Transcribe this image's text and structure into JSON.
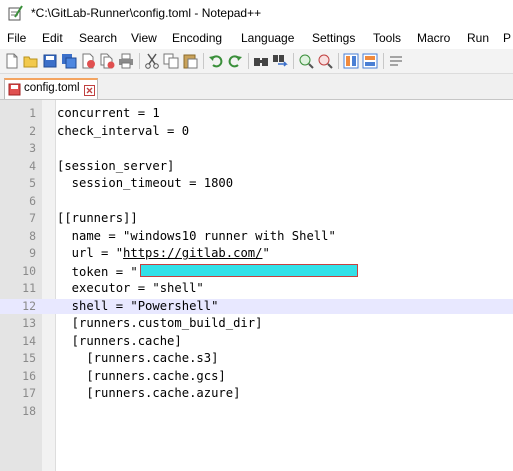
{
  "window": {
    "title": "*C:\\GitLab-Runner\\config.toml - Notepad++"
  },
  "menu": [
    "File",
    "Edit",
    "Search",
    "View",
    "Encoding",
    "Language",
    "Settings",
    "Tools",
    "Macro",
    "Run",
    "P"
  ],
  "toolbar_icons": [
    "new-file-icon",
    "open-file-icon",
    "save-icon",
    "save-all-icon",
    "close-icon",
    "close-all-icon",
    "print-icon",
    "cut-icon",
    "copy-icon",
    "paste-icon",
    "undo-icon",
    "redo-icon",
    "find-icon",
    "replace-icon",
    "zoom-in-icon",
    "zoom-out-icon",
    "sync-vertical-icon",
    "sync-horizontal-icon",
    "word-wrap-icon"
  ],
  "tab": {
    "label": "config.toml"
  },
  "editor": {
    "line_numbers": [
      "1",
      "2",
      "3",
      "4",
      "5",
      "6",
      "7",
      "8",
      "9",
      "10",
      "11",
      "12",
      "13",
      "14",
      "15",
      "16",
      "17",
      "18"
    ],
    "current_line": 12,
    "lines": {
      "l1": "concurrent = 1",
      "l2": "check_interval = 0",
      "l3": "",
      "l4": "[session_server]",
      "l5": "  session_timeout = 1800",
      "l6": "",
      "l7": "[[runners]]",
      "l8": "  name = \"windows10 runner with Shell\"",
      "l9_pre": "  url = \"",
      "l9_url": "https://gitlab.com/",
      "l9_post": "\"",
      "l10_pre": "  token = \"",
      "l11": "  executor = \"shell\"",
      "l12": "  shell = \"Powershell\"",
      "l13": "  [runners.custom_build_dir]",
      "l14": "  [runners.cache]",
      "l15": "    [runners.cache.s3]",
      "l16": "    [runners.cache.gcs]",
      "l17": "    [runners.cache.azure]",
      "l18": ""
    }
  },
  "colors": {
    "redaction_fill": "#33e0e8",
    "redaction_border": "#c84040",
    "tab_accent": "#f4a460",
    "current_line": "#e8e8ff"
  }
}
